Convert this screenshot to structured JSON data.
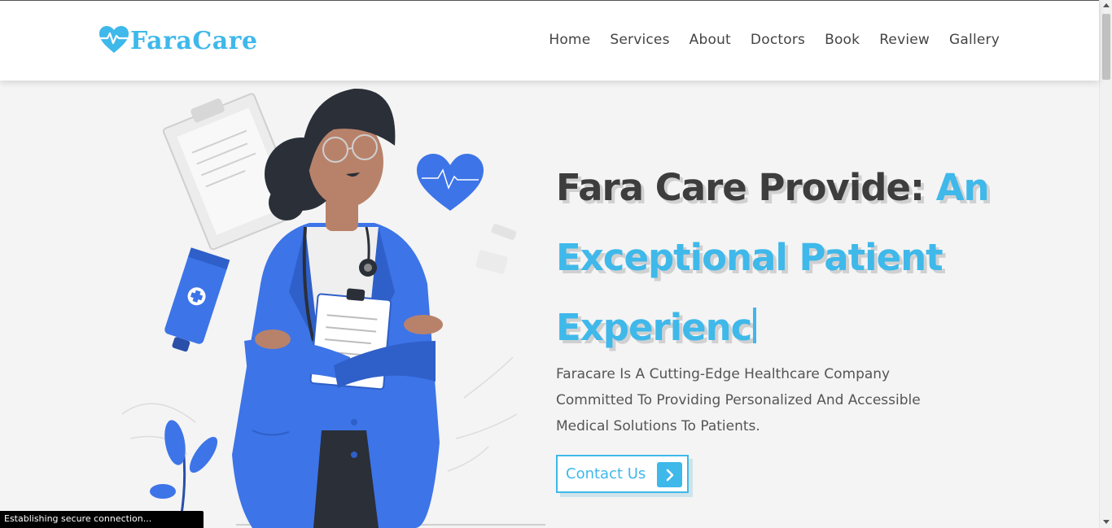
{
  "brand": {
    "name": "FaraCare",
    "color": "#3fb8ea",
    "icon": "heart-pulse-icon"
  },
  "nav": {
    "items": [
      {
        "label": "Home"
      },
      {
        "label": "Services"
      },
      {
        "label": "About"
      },
      {
        "label": "Doctors"
      },
      {
        "label": "Book"
      },
      {
        "label": "Review"
      },
      {
        "label": "Gallery"
      }
    ]
  },
  "hero": {
    "title_prefix": "Fara Care Provide: ",
    "title_accent": "An Exceptional Patient Experienc",
    "description": "Faracare Is A Cutting-Edge Healthcare Company Committed To Providing Personalized And Accessible Medical Solutions To Patients.",
    "cta_label": "Contact Us",
    "cta_icon": "chevron-right-icon",
    "illustration": "doctor-illustration"
  },
  "status_bar": {
    "text": "Establishing secure connection..."
  },
  "colors": {
    "accent": "#3fb8ea",
    "doctor_coat": "#3d74e8",
    "text_dark": "#3d3d3d"
  }
}
